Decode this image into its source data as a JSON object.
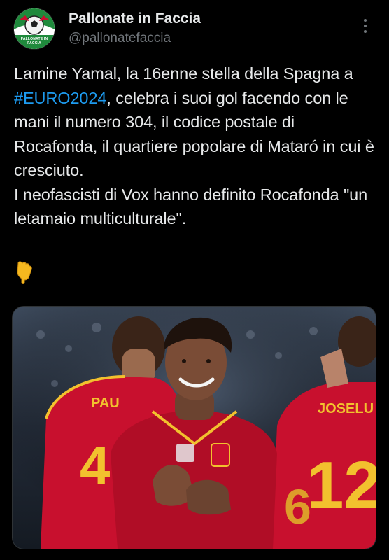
{
  "author": {
    "display_name": "Pallonate in Faccia",
    "handle": "@pallonatefaccia",
    "avatar_text": "PALLONATE IN FACCIA"
  },
  "tweet": {
    "text_before": "Lamine Yamal, la 16enne stella della Spagna a ",
    "hashtag": "#EURO2024",
    "text_after": ", celebra i suoi gol facendo con le mani il numero 304, il codice postale di Rocafonda, il quartiere popolare di Mataró in cui è cresciuto.\nI neofascisti di Vox hanno definito Rocafonda \"un letamaio multiculturale\".",
    "emoji": "👇"
  },
  "media": {
    "jersey_left_name": "PAU",
    "jersey_left_number": "4",
    "jersey_right_name": "JOSELU",
    "jersey_right_number": "12",
    "jersey_back_number": "6"
  },
  "colors": {
    "background": "#000000",
    "text": "#e7e9ea",
    "secondary": "#71767b",
    "link": "#1d9bf0",
    "jersey_red": "#c8102e",
    "jersey_yellow": "#f2c12e"
  },
  "icons": {
    "more": "more-options-icon",
    "emoji": "backhand-index-pointing-down-icon"
  }
}
